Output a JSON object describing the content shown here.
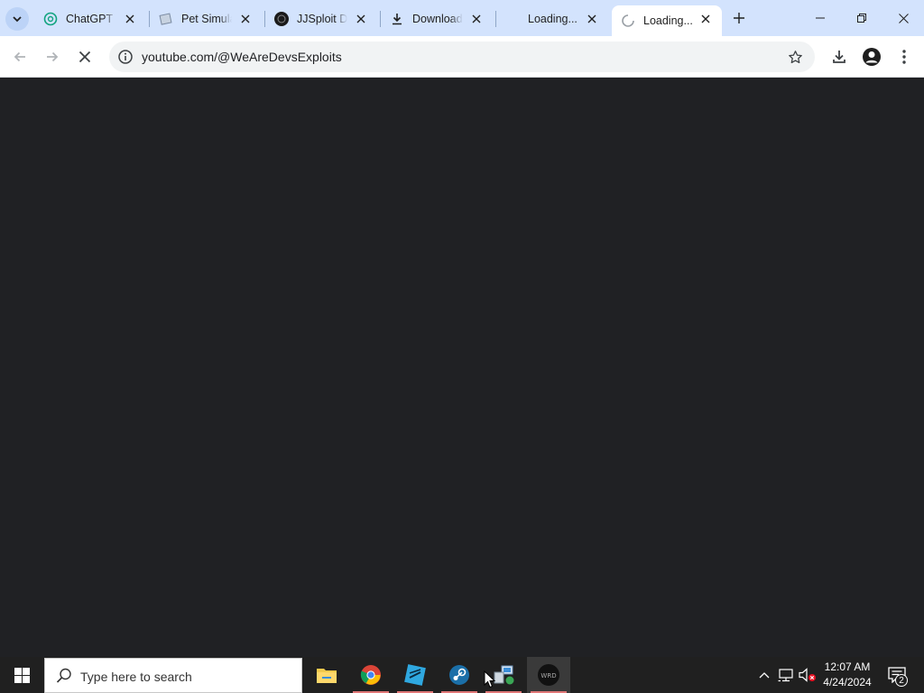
{
  "browser": {
    "tabs": [
      {
        "title": "ChatGPT",
        "icon": "chatgpt-icon"
      },
      {
        "title": "Pet Simulator",
        "icon": "page-icon"
      },
      {
        "title": "JJSploit Download",
        "icon": "wrd-icon"
      },
      {
        "title": "Download",
        "icon": "download-icon"
      },
      {
        "title": "Loading...",
        "icon": "blank-icon"
      },
      {
        "title": "Loading...",
        "icon": "spinner-icon",
        "active": true
      }
    ],
    "address_bar": {
      "url": "youtube.com/@WeAreDevsExploits"
    }
  },
  "taskbar": {
    "search_placeholder": "Type here to search",
    "apps": [
      "file-explorer-icon",
      "chrome-icon",
      "roblox-studio-icon",
      "steam-icon",
      "network-app-icon",
      "wrd-app-icon"
    ],
    "clock_time": "12:07 AM",
    "clock_date": "4/24/2024",
    "notification_count": "2"
  },
  "colors": {
    "tabstrip": "#d3e3fd",
    "toolbar": "#ffffff",
    "page_background": "#202124",
    "taskbar": "#202020"
  }
}
